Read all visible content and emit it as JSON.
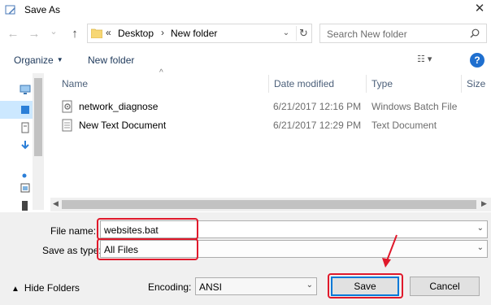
{
  "window": {
    "title": "Save As",
    "close_glyph": "✕"
  },
  "nav": {
    "back_glyph": "←",
    "forward_glyph": "→",
    "recent_glyph": "⌄",
    "up_glyph": "↑",
    "breadcrumb": {
      "overflow": "«",
      "items": [
        "Desktop",
        "New folder"
      ],
      "separator": "›"
    },
    "dropdown_glyph": "⌄",
    "refresh_glyph": "↻",
    "search_placeholder": "Search New folder"
  },
  "toolbar": {
    "organize_label": "Organize",
    "organize_caret": "▼",
    "new_folder_label": "New folder",
    "view_glyph": "☷ ▾",
    "help_glyph": "?"
  },
  "file_list": {
    "columns": [
      "Name",
      "Date modified",
      "Type",
      "Size"
    ],
    "sort_caret": "^",
    "rows": [
      {
        "name": "network_diagnose",
        "date": "6/21/2017 12:16 PM",
        "type": "Windows Batch File",
        "icon": "batch-file-icon"
      },
      {
        "name": "New Text Document",
        "date": "6/21/2017 12:29 PM",
        "type": "Text Document",
        "icon": "text-file-icon"
      }
    ]
  },
  "hscroll": {
    "left_glyph": "◀",
    "right_glyph": "▶"
  },
  "save_form": {
    "file_name_label": "File name:",
    "file_name_value": "websites.bat",
    "save_type_label": "Save as type:",
    "save_type_value": "All Files",
    "dropdown_glyph": "⌄"
  },
  "footer": {
    "hide_folders_label": "Hide Folders",
    "hide_folders_chevron": "▲",
    "encoding_label": "Encoding:",
    "encoding_value": "ANSI",
    "save_label": "Save",
    "cancel_label": "Cancel"
  },
  "colors": {
    "accent": "#0078d7",
    "annotation": "#e0192b",
    "selection": "#cce8ff"
  }
}
